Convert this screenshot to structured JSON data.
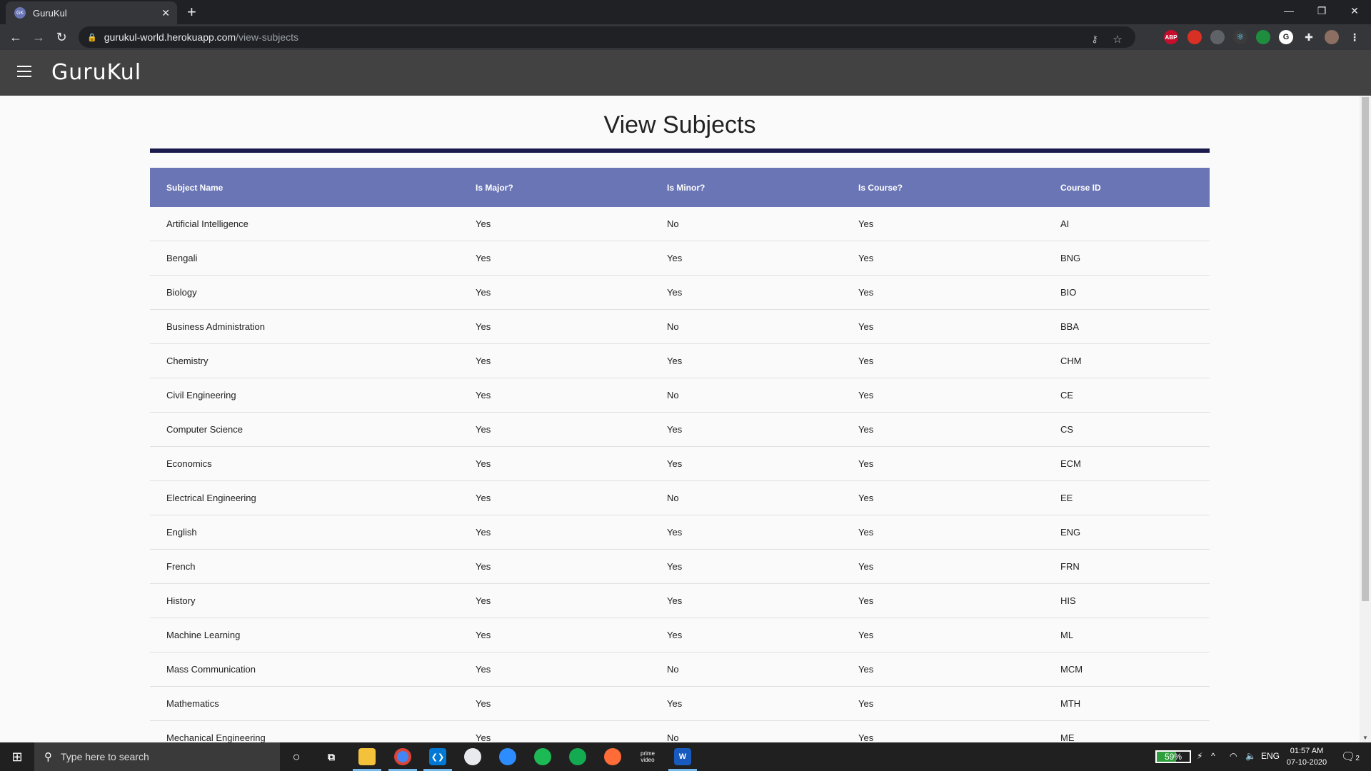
{
  "browser": {
    "tab_title": "GuruKul",
    "tab_favicon": "GK",
    "tab_close": "✕",
    "new_tab": "+",
    "window_controls": [
      "—",
      "❐",
      "✕"
    ],
    "url_host": "gurukul-world.herokuapp.com",
    "url_path": "/view-subjects",
    "extensions": [
      {
        "icon": "adblock-icon",
        "text": "ABP",
        "color": "#c70d2c"
      },
      {
        "icon": "red-extension-icon",
        "text": "",
        "color": "#d93025"
      },
      {
        "icon": "grey-extension-icon",
        "text": "",
        "color": "#5f6368"
      },
      {
        "icon": "react-devtools-icon",
        "text": "⚛",
        "color": "#3b3b3b"
      },
      {
        "icon": "green-extension-icon",
        "text": "",
        "color": "#1e8e3e"
      },
      {
        "icon": "grammarly-icon",
        "text": "G",
        "color": "#ffffff"
      }
    ]
  },
  "app": {
    "brand": "GuruKul",
    "menu_icon": "hamburger-menu-icon"
  },
  "page": {
    "title": "View Subjects",
    "accent": "#1a1a4e",
    "header_color": "#6a75b5"
  },
  "table": {
    "columns": [
      "Subject Name",
      "Is Major?",
      "Is Minor?",
      "Is Course?",
      "Course ID"
    ],
    "rows": [
      [
        "Artificial Intelligence",
        "Yes",
        "No",
        "Yes",
        "AI"
      ],
      [
        "Bengali",
        "Yes",
        "Yes",
        "Yes",
        "BNG"
      ],
      [
        "Biology",
        "Yes",
        "Yes",
        "Yes",
        "BIO"
      ],
      [
        "Business Administration",
        "Yes",
        "No",
        "Yes",
        "BBA"
      ],
      [
        "Chemistry",
        "Yes",
        "Yes",
        "Yes",
        "CHM"
      ],
      [
        "Civil Engineering",
        "Yes",
        "No",
        "Yes",
        "CE"
      ],
      [
        "Computer Science",
        "Yes",
        "Yes",
        "Yes",
        "CS"
      ],
      [
        "Economics",
        "Yes",
        "Yes",
        "Yes",
        "ECM"
      ],
      [
        "Electrical Engineering",
        "Yes",
        "No",
        "Yes",
        "EE"
      ],
      [
        "English",
        "Yes",
        "Yes",
        "Yes",
        "ENG"
      ],
      [
        "French",
        "Yes",
        "Yes",
        "Yes",
        "FRN"
      ],
      [
        "History",
        "Yes",
        "Yes",
        "Yes",
        "HIS"
      ],
      [
        "Machine Learning",
        "Yes",
        "Yes",
        "Yes",
        "ML"
      ],
      [
        "Mass Communication",
        "Yes",
        "No",
        "Yes",
        "MCM"
      ],
      [
        "Mathematics",
        "Yes",
        "Yes",
        "Yes",
        "MTH"
      ],
      [
        "Mechanical Engineering",
        "Yes",
        "No",
        "Yes",
        "ME"
      ]
    ]
  },
  "taskbar": {
    "search_placeholder": "Type here to search",
    "battery": "59%",
    "battery_level": 0.59,
    "language": "ENG",
    "time": "01:57 AM",
    "date": "07-10-2020",
    "notification_count": "2"
  }
}
